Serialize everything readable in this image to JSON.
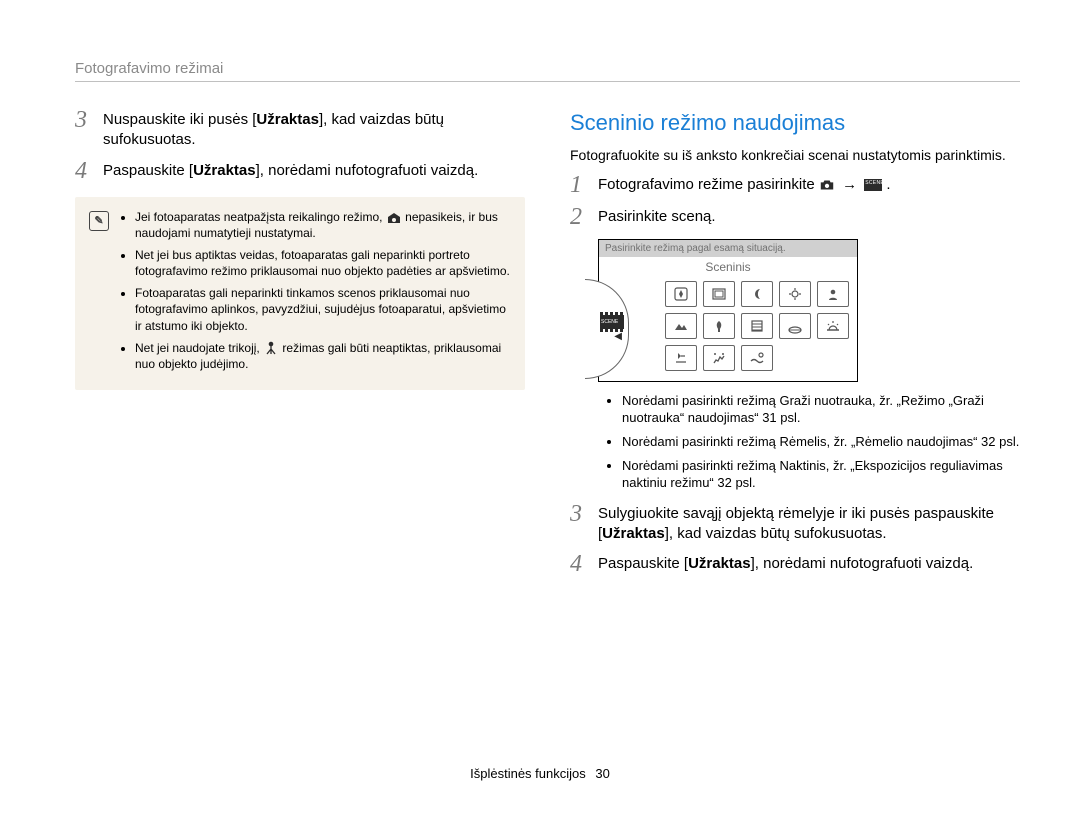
{
  "header": "Fotografavimo režimai",
  "left": {
    "step3_num": "3",
    "step3_a": "Nuspauskite iki pusės [",
    "step3_b": "Užraktas",
    "step3_c": "], kad vaizdas būtų sufokusuotas.",
    "step4_num": "4",
    "step4_a": "Paspauskite [",
    "step4_b": "Užraktas",
    "step4_c": "], norėdami nufotografuoti vaizdą.",
    "note_bullets": [
      {
        "a": "Jei fotoaparatas neatpažįsta reikalingo režimo, ",
        "b": " nepasikeis, ir bus naudojami numatytieji nustatymai."
      },
      "Net jei bus aptiktas veidas, fotoaparatas gali neparinkti portreto fotografavimo režimo priklausomai nuo objekto padėties ar apšvietimo.",
      "Fotoaparatas gali neparinkti tinkamos scenos priklausomai nuo fotografavimo aplinkos, pavyzdžiui, sujudėjus fotoaparatui, apšvietimo ir atstumo iki objekto.",
      {
        "a": "Net jei naudojate trikojį, ",
        "b": " režimas gali būti neaptiktas, priklausomai nuo objekto judėjimo."
      }
    ]
  },
  "right": {
    "heading": "Sceninio režimo naudojimas",
    "intro": "Fotografuokite su iš anksto konkrečiai scenai nustatytomis parinktimis.",
    "step1_num": "1",
    "step1_text": "Fotografavimo režime pasirinkite ",
    "step2_num": "2",
    "step2_text": "Pasirinkite sceną.",
    "screen_bar": "Pasirinkite režimą pagal esamą situaciją.",
    "screen_label": "Sceninis",
    "dial_label": "SCENE",
    "sub_bullets": [
      "Norėdami pasirinkti režimą Graži nuotrauka, žr. „Režimo „Graži nuotrauka“ naudojimas“ 31 psl.",
      "Norėdami pasirinkti režimą Rėmelis, žr. „Rėmelio naudojimas“ 32 psl.",
      "Norėdami pasirinkti režimą Naktinis, žr. „Ekspozicijos reguliavimas naktiniu režimu“ 32 psl."
    ],
    "step3_num": "3",
    "step3_a": "Sulygiuokite savąjį objektą rėmelyje ir iki pusės paspauskite [",
    "step3_b": "Užraktas",
    "step3_c": "], kad vaizdas būtų sufokusuotas.",
    "step4_num": "4",
    "step4_a": "Paspauskite [",
    "step4_b": "Užraktas",
    "step4_c": "], norėdami nufotografuoti vaizdą."
  },
  "footer": {
    "label": "Išplėstinės funkcijos",
    "page": "30"
  }
}
